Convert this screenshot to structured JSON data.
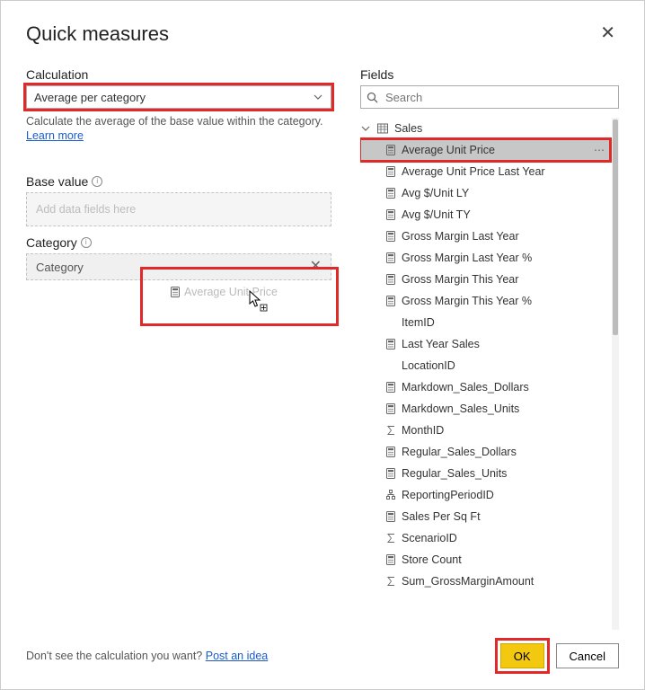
{
  "header": {
    "title": "Quick measures"
  },
  "left": {
    "calc_label": "Calculation",
    "calc_value": "Average per category",
    "calc_desc": "Calculate the average of the base value within the category.",
    "learn_more": "Learn more",
    "base_label": "Base value",
    "base_placeholder": "Add data fields here",
    "base_ghost": "Average Unit Price",
    "cat_label": "Category",
    "cat_value": "Category"
  },
  "right": {
    "fields_label": "Fields",
    "search_placeholder": "Search",
    "parent": "Sales",
    "items": [
      {
        "label": "Average Unit Price",
        "icon": "calc",
        "selected": true
      },
      {
        "label": "Average Unit Price Last Year",
        "icon": "calc"
      },
      {
        "label": "Avg $/Unit LY",
        "icon": "calc"
      },
      {
        "label": "Avg $/Unit TY",
        "icon": "calc"
      },
      {
        "label": "Gross Margin Last Year",
        "icon": "calc"
      },
      {
        "label": "Gross Margin Last Year %",
        "icon": "calc"
      },
      {
        "label": "Gross Margin This Year",
        "icon": "calc"
      },
      {
        "label": "Gross Margin This Year %",
        "icon": "calc"
      },
      {
        "label": "ItemID",
        "icon": "none"
      },
      {
        "label": "Last Year Sales",
        "icon": "calc"
      },
      {
        "label": "LocationID",
        "icon": "none"
      },
      {
        "label": "Markdown_Sales_Dollars",
        "icon": "calc"
      },
      {
        "label": "Markdown_Sales_Units",
        "icon": "calc"
      },
      {
        "label": "MonthID",
        "icon": "sigma"
      },
      {
        "label": "Regular_Sales_Dollars",
        "icon": "calc"
      },
      {
        "label": "Regular_Sales_Units",
        "icon": "calc"
      },
      {
        "label": "ReportingPeriodID",
        "icon": "hierarchy"
      },
      {
        "label": "Sales Per Sq Ft",
        "icon": "calc"
      },
      {
        "label": "ScenarioID",
        "icon": "sigma"
      },
      {
        "label": "Store Count",
        "icon": "calc"
      },
      {
        "label": "Sum_GrossMarginAmount",
        "icon": "sigma"
      }
    ]
  },
  "footer": {
    "prompt": "Don't see the calculation you want? ",
    "post": "Post an idea",
    "ok": "OK",
    "cancel": "Cancel"
  }
}
